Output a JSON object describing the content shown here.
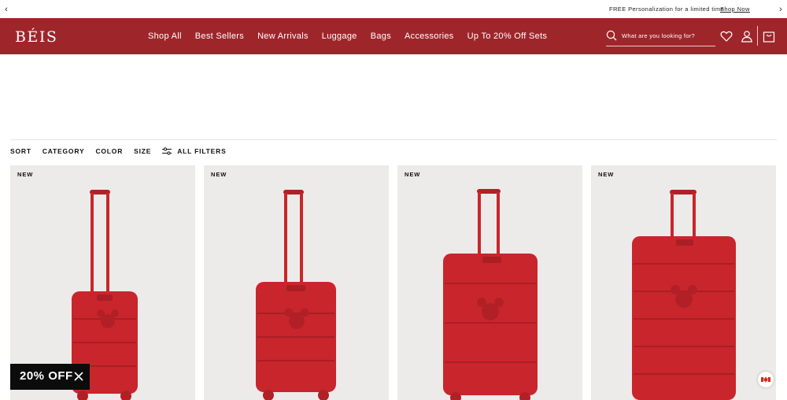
{
  "announcement": {
    "message": "FREE Personalization for a limited time.",
    "link": "Shop Now",
    "prev_icon": "chevron-left-icon",
    "next_icon": "chevron-right-icon"
  },
  "header": {
    "logo": "BÉIS",
    "nav": [
      {
        "label": "Shop All"
      },
      {
        "label": "Best Sellers"
      },
      {
        "label": "New Arrivals"
      },
      {
        "label": "Luggage"
      },
      {
        "label": "Bags"
      },
      {
        "label": "Accessories"
      },
      {
        "label": "Up To 20% Off Sets"
      }
    ],
    "search_placeholder": "What are you looking for?",
    "icons": [
      "search-icon",
      "heart-icon",
      "user-icon",
      "bag-icon"
    ],
    "brand_color": "#9e262b"
  },
  "filters": {
    "sort": "SORT",
    "category": "CATEGORY",
    "color": "COLOR",
    "size": "SIZE",
    "all_filters": "ALL FILTERS"
  },
  "products": [
    {
      "badge": "NEW"
    },
    {
      "badge": "NEW"
    },
    {
      "badge": "NEW"
    },
    {
      "badge": "NEW"
    }
  ],
  "promo": {
    "label": "20% OFF",
    "close_icon": "close-icon"
  },
  "colors": {
    "luggage_red": "#c8262c",
    "card_bg": "#ecebe9"
  }
}
